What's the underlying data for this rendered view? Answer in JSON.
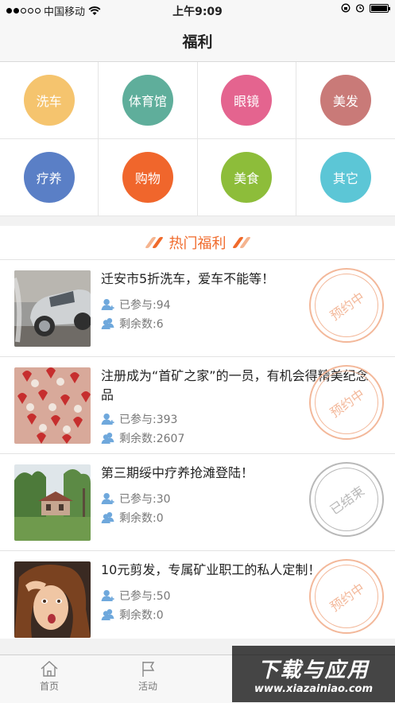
{
  "status_bar": {
    "carrier": "中国移动",
    "time": "上午9:09"
  },
  "nav": {
    "title": "福利"
  },
  "categories": [
    {
      "label": "洗车",
      "color": "#f5c46e"
    },
    {
      "label": "体育馆",
      "color": "#5fae9b"
    },
    {
      "label": "眼镜",
      "color": "#e4648f"
    },
    {
      "label": "美发",
      "color": "#c97a78"
    },
    {
      "label": "疗养",
      "color": "#5a7fc6"
    },
    {
      "label": "购物",
      "color": "#f0662c"
    },
    {
      "label": "美食",
      "color": "#8dbd3a"
    },
    {
      "label": "其它",
      "color": "#5cc6d6"
    }
  ],
  "hot_section": {
    "title": "热门福利"
  },
  "list": [
    {
      "title": "迁安市5折洗车，爱车不能等！",
      "joined": "已参与:94",
      "remaining": "剩余数:6",
      "status": "预约中",
      "status_color": "#f3b89a"
    },
    {
      "title": "注册成为“首矿之家”的一员，有机会得精美纪念品",
      "joined": "已参与:393",
      "remaining": "剩余数:2607",
      "status": "预约中",
      "status_color": "#f3b89a"
    },
    {
      "title": "第三期绥中疗养抢滩登陆！",
      "joined": "已参与:30",
      "remaining": "剩余数:0",
      "status": "已结束",
      "status_color": "#b8b8b8"
    },
    {
      "title": "10元剪发，专属矿业职工的私人定制！",
      "joined": "已参与:50",
      "remaining": "剩余数:0",
      "status": "预约中",
      "status_color": "#f3b89a"
    }
  ],
  "tabbar": {
    "home": "首页",
    "activity": "活动"
  },
  "watermark": {
    "main": "下载与应用",
    "url": "www.xiazainiao.com"
  },
  "colors": {
    "accent": "#f06a2b",
    "user_icon": "#6fa8dc"
  }
}
